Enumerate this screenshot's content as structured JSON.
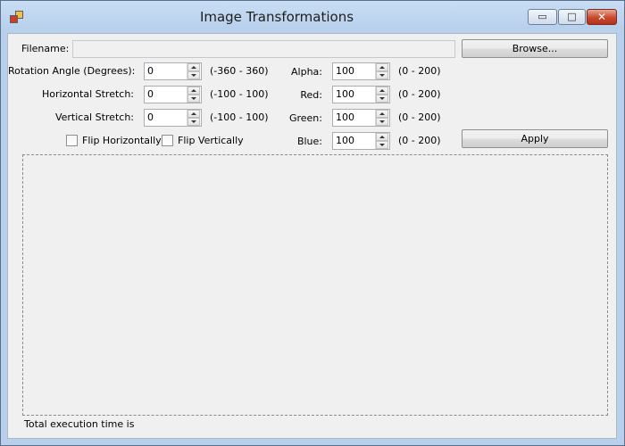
{
  "window": {
    "title": "Image Transformations",
    "min_glyph": "▭",
    "max_glyph": "□",
    "close_glyph": "✕"
  },
  "filename": {
    "label": "Filename:",
    "value": "",
    "browse_label": "Browse..."
  },
  "left_controls": [
    {
      "label": "Rotation Angle (Degrees):",
      "value": "0",
      "range": "(-360 - 360)"
    },
    {
      "label": "Horizontal Stretch:",
      "value": "0",
      "range": "(-100 - 100)"
    },
    {
      "label": "Vertical Stretch:",
      "value": "0",
      "range": "(-100 - 100)"
    }
  ],
  "right_controls": [
    {
      "label": "Alpha:",
      "value": "100",
      "range": "(0 - 200)"
    },
    {
      "label": "Red:",
      "value": "100",
      "range": "(0 - 200)"
    },
    {
      "label": "Green:",
      "value": "100",
      "range": "(0 - 200)"
    },
    {
      "label": "Blue:",
      "value": "100",
      "range": "(0 - 200)"
    }
  ],
  "checkboxes": {
    "flip_h": "Flip Horizontally",
    "flip_v": "Flip Vertically"
  },
  "apply_label": "Apply",
  "status": {
    "text": "Total execution time is"
  }
}
